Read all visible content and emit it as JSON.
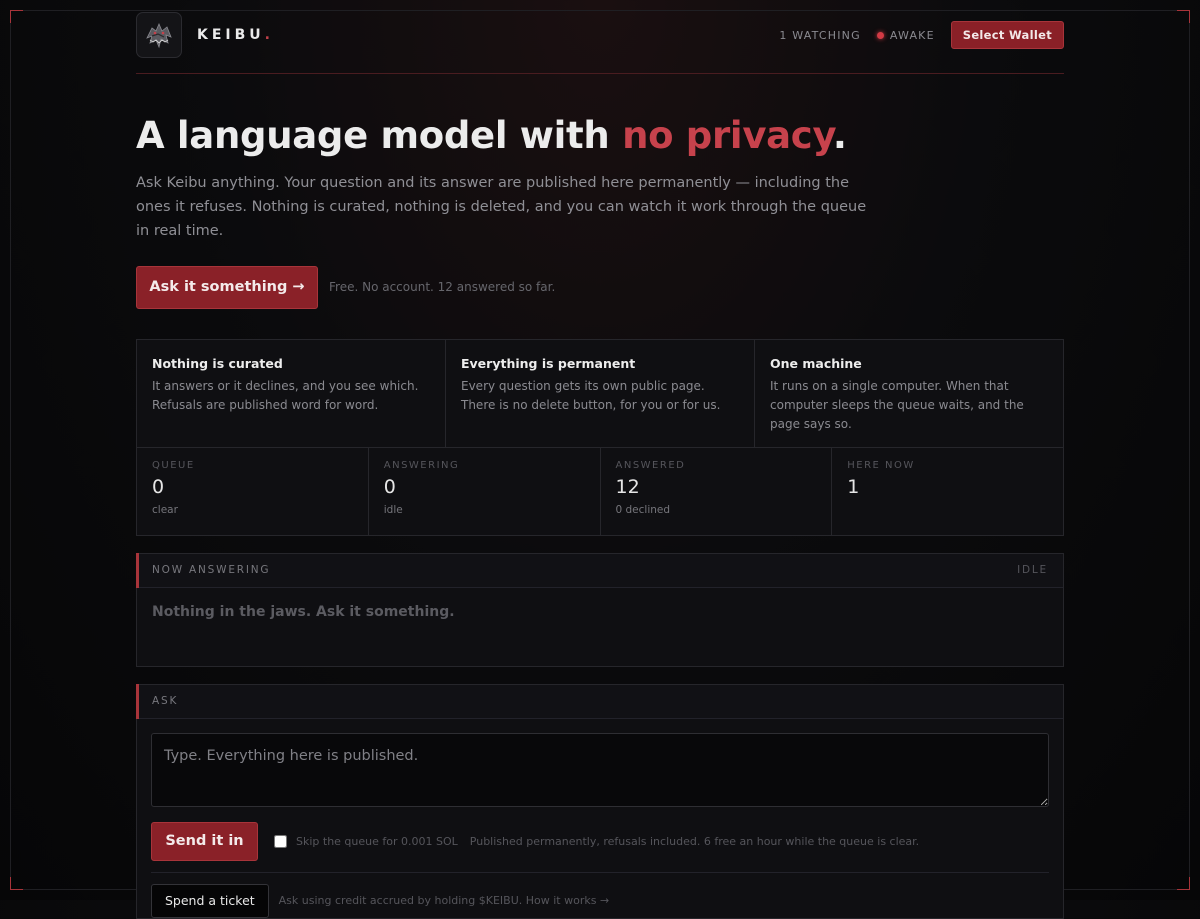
{
  "header": {
    "logo_icon": "dragon-head-icon",
    "brand_name": "KEIBU",
    "brand_dot": ".",
    "watching": "1 WATCHING",
    "status": "AWAKE",
    "status_color": "#d23a44",
    "wallet_button": "Select Wallet"
  },
  "hero": {
    "title_start": "A language model with ",
    "title_accent": "no privacy",
    "title_end": ".",
    "lede": "Ask Keibu anything. Your question and its answer are published here permanently — including the ones it refuses. Nothing is curated, nothing is deleted, and you can watch it work through the queue in real time.",
    "cta_label": "Ask it something →",
    "cta_note": "Free. No account. 12 answered so far."
  },
  "features": [
    {
      "title": "Nothing is curated",
      "text": "It answers or it declines, and you see which. Refusals are published word for word."
    },
    {
      "title": "Everything is permanent",
      "text": "Every question gets its own public page. There is no delete button, for you or for us."
    },
    {
      "title": "One machine",
      "text": "It runs on a single computer. When that computer sleeps the queue waits, and the page says so."
    }
  ],
  "stats": [
    {
      "label": "QUEUE",
      "value": "0",
      "sub": "clear"
    },
    {
      "label": "ANSWERING",
      "value": "0",
      "sub": "idle"
    },
    {
      "label": "ANSWERED",
      "value": "12",
      "sub": "0 declined"
    },
    {
      "label": "HERE NOW",
      "value": "1",
      "sub": ""
    }
  ],
  "now_answering": {
    "title": "NOW ANSWERING",
    "state": "IDLE",
    "empty_text": "Nothing in the jaws. Ask it something."
  },
  "ask": {
    "title": "ASK",
    "placeholder": "Type. Everything here is published.",
    "value": "",
    "send_label": "Send it in",
    "skip_label": "Skip the queue for 0.001 SOL",
    "info": "Published permanently, refusals included. 6 free an hour while the queue is clear.",
    "ticket_label": "Spend a ticket",
    "ticket_note": "Ask using credit accrued by holding $KEIBU.",
    "ticket_link": "How it works →"
  },
  "colors": {
    "accent": "#c7424c",
    "button_bg": "#8a2128",
    "background": "#0b0b0d"
  }
}
